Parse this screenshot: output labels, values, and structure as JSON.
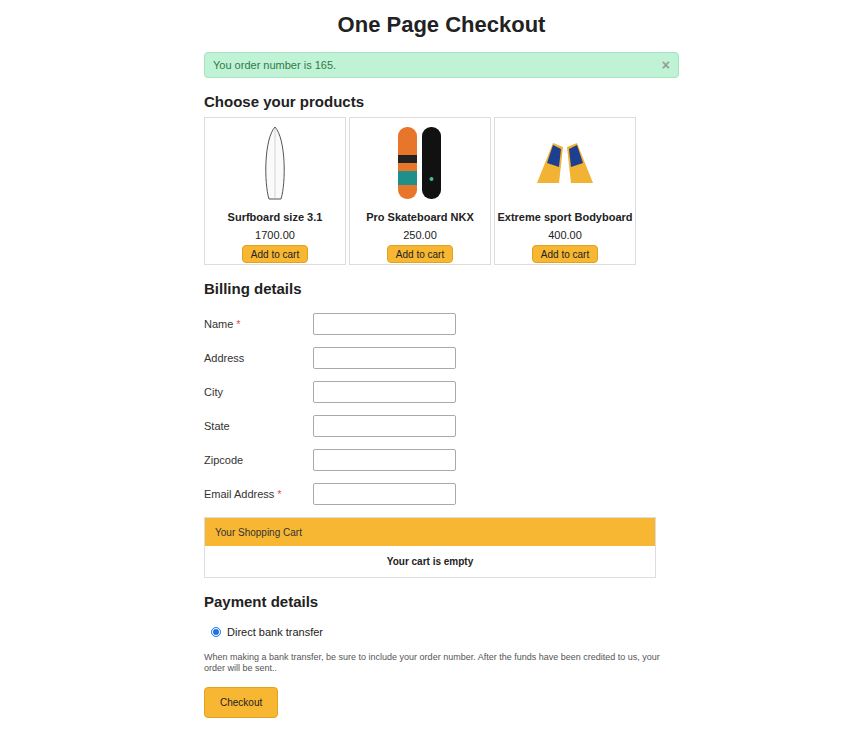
{
  "page": {
    "title": "One Page Checkout"
  },
  "alert": {
    "message": "You order number is 165.",
    "close": "×"
  },
  "products": {
    "heading": "Choose your products",
    "items": [
      {
        "kind": "surfboard",
        "name": "Surfboard size 3.1",
        "price": "1700.00",
        "button": "Add to cart"
      },
      {
        "kind": "skateboard",
        "name": "Pro Skateboard NKX",
        "price": "250.00",
        "button": "Add to cart"
      },
      {
        "kind": "fins",
        "name": "Extreme sport Bodyboard",
        "price": "400.00",
        "button": "Add to cart"
      }
    ]
  },
  "billing": {
    "heading": "Billing details",
    "required_mark": "*",
    "fields": [
      {
        "label": "Name",
        "required": true,
        "value": ""
      },
      {
        "label": "Address",
        "required": false,
        "value": ""
      },
      {
        "label": "City",
        "required": false,
        "value": ""
      },
      {
        "label": "State",
        "required": false,
        "value": ""
      },
      {
        "label": "Zipcode",
        "required": false,
        "value": ""
      },
      {
        "label": "Email Address",
        "required": true,
        "value": ""
      }
    ]
  },
  "cart": {
    "title": "Your Shopping Cart",
    "empty_message": "Your cart is empty"
  },
  "payment": {
    "heading": "Payment details",
    "methods": [
      {
        "label": "Direct bank transfer",
        "selected": true
      }
    ],
    "note": "When making a bank transfer, be sure to include your order number. After the funds have been credited to us, your order will be sent.."
  },
  "checkout_button": "Checkout"
}
